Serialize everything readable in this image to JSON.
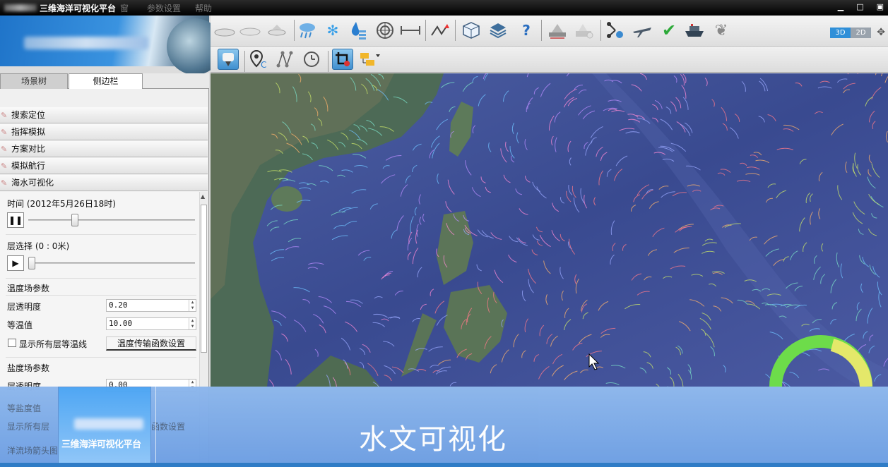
{
  "titlebar": {
    "title": "三维海洋可视化平台",
    "menu": [
      "窗口",
      "参数设置",
      "帮助"
    ],
    "window_buttons": [
      "▁",
      "□",
      "▣"
    ]
  },
  "view_mode": {
    "three_d": "3D",
    "two_d": "2D",
    "selected": "3D"
  },
  "toolbar_icons": [
    "cloud-icon",
    "rain-icon",
    "snow-icon",
    "water-level-icon",
    "radar-icon",
    "distance-icon",
    "route-icon",
    "cube-icon",
    "layers-icon",
    "help-icon",
    "ship-station-icon",
    "ship-icon",
    "workflow-icon",
    "plane-icon",
    "check-icon",
    "vessel-icon",
    "leaf-icon"
  ],
  "toolbar_help": "?",
  "tabs": {
    "scene_tree": "场景树",
    "sidebar": "侧边栏",
    "active": "sidebar"
  },
  "nav": {
    "items": [
      "搜索定位",
      "指挥模拟",
      "方案对比",
      "模拟航行",
      "海水可视化"
    ]
  },
  "settings": {
    "time_label": "时间 (2012年5月26日18时)",
    "time_progress": 0.26,
    "layer_label": "层选择 (0 : 0米)",
    "layer_progress": 0.0,
    "pause_symbol": "❚❚",
    "play_symbol": "▶",
    "temperature": {
      "title": "温度场参数",
      "opacity_label": "层透明度",
      "opacity_value": "0.20",
      "iso_label": "等温值",
      "iso_value": "10.00",
      "show_all_label": "显示所有层等温线",
      "transfer_button": "温度传输函数设置"
    },
    "salinity": {
      "title": "盐度场参数",
      "opacity_label": "层透明度",
      "opacity_value": "0.00",
      "iso_label": "等盐度值",
      "show_all_label": "显示所有层",
      "transfer_button_partial": "函数设置"
    },
    "current": {
      "title": "洋流场箭头图"
    }
  },
  "banner": {
    "thumb_caption": "三维海洋可视化平台",
    "main_caption": "水文可视化"
  },
  "colors": {
    "accent": "#2f8fd8",
    "banner": "#7aa9e8",
    "map_ocean": "#3d4b8c"
  }
}
